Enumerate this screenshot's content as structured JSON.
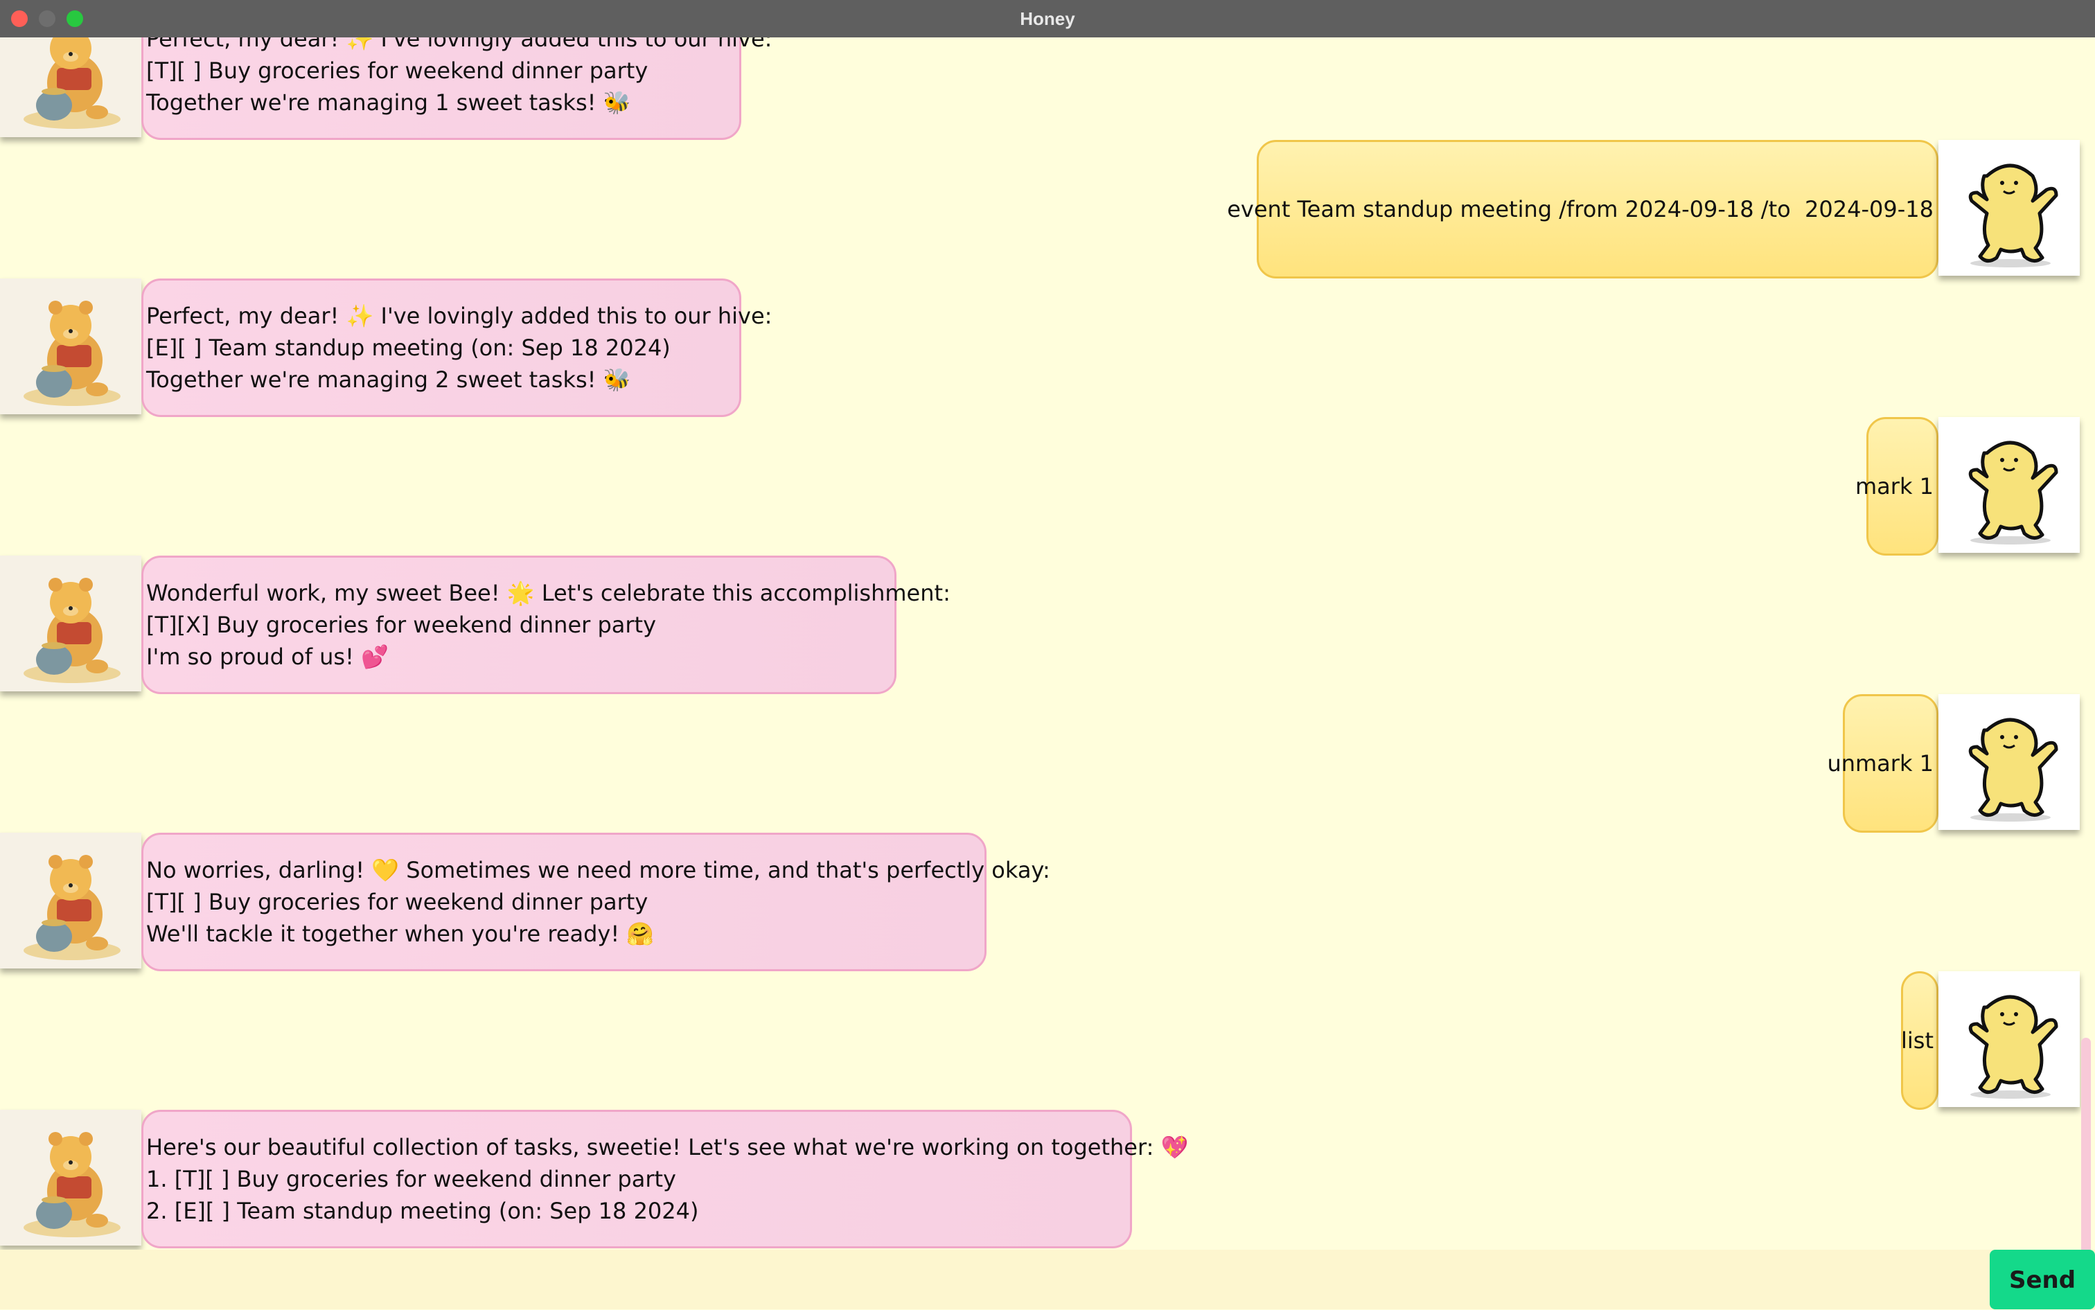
{
  "window": {
    "title": "Honey"
  },
  "messages": [
    {
      "role": "bot",
      "lines": [
        "Perfect, my dear! ✨ I've lovingly added this to our hive:",
        "[T][ ] Buy groceries for weekend dinner party",
        "Together we're managing 1 sweet tasks! 🐝"
      ]
    },
    {
      "role": "user",
      "text": "event Team standup meeting /from 2024-09-18 /to  2024-09-18"
    },
    {
      "role": "bot",
      "lines": [
        "Perfect, my dear! ✨ I've lovingly added this to our hive:",
        "[E][ ] Team standup meeting (on: Sep 18 2024)",
        "Together we're managing 2 sweet tasks! 🐝"
      ]
    },
    {
      "role": "user",
      "text": "mark 1"
    },
    {
      "role": "bot",
      "lines": [
        "Wonderful work, my sweet Bee! 🌟 Let's celebrate this accomplishment:",
        "[T][X] Buy groceries for weekend dinner party",
        "I'm so proud of us! 💕"
      ]
    },
    {
      "role": "user",
      "text": "unmark 1"
    },
    {
      "role": "bot",
      "lines": [
        "No worries, darling! 💛 Sometimes we need more time, and that's perfectly okay:",
        "[T][ ] Buy groceries for weekend dinner party",
        "We'll tackle it together when you're ready! 🤗"
      ]
    },
    {
      "role": "user",
      "text": "list"
    },
    {
      "role": "bot",
      "lines": [
        "Here's our beautiful collection of tasks, sweetie! Let's see what we're working on together: 💖",
        "1. [T][ ] Buy groceries for weekend dinner party",
        "2. [E][ ] Team standup meeting (on: Sep 18 2024)"
      ]
    }
  ],
  "input": {
    "value": "",
    "placeholder": ""
  },
  "send_button": {
    "label": "Send"
  }
}
